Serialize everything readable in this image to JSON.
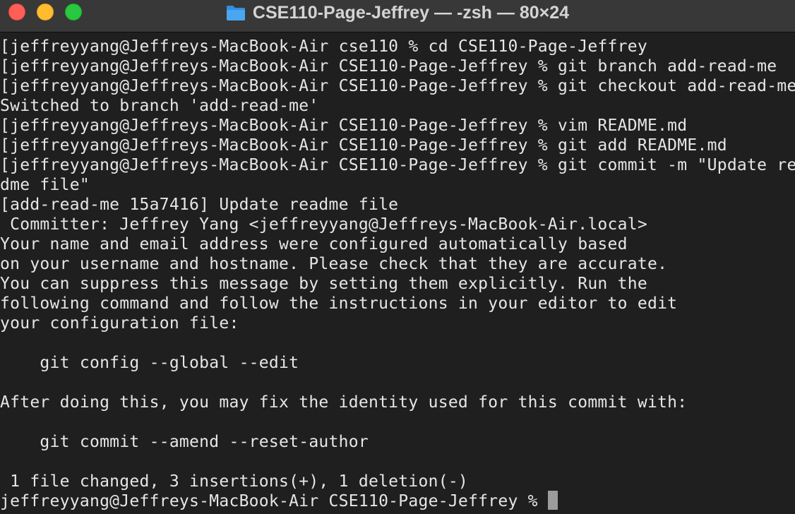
{
  "window": {
    "title": "CSE110-Page-Jeffrey — -zsh — 80×24",
    "icon": "folder-icon",
    "colors": {
      "background": "#1f1f1f",
      "titlebar": "#383838",
      "text": "#e6e6e6",
      "close": "#ff5f57",
      "minimize": "#febc2e",
      "maximize": "#28c840",
      "cursor": "#9c9c9c"
    }
  },
  "terminal": {
    "lines": [
      "[jeffreyyang@Jeffreys-MacBook-Air cse110 % cd CSE110-Page-Jeffrey",
      "[jeffreyyang@Jeffreys-MacBook-Air CSE110-Page-Jeffrey % git branch add-read-me",
      "[jeffreyyang@Jeffreys-MacBook-Air CSE110-Page-Jeffrey % git checkout add-read-me",
      "Switched to branch 'add-read-me'",
      "[jeffreyyang@Jeffreys-MacBook-Air CSE110-Page-Jeffrey % vim README.md",
      "[jeffreyyang@Jeffreys-MacBook-Air CSE110-Page-Jeffrey % git add README.md",
      "[jeffreyyang@Jeffreys-MacBook-Air CSE110-Page-Jeffrey % git commit -m \"Update rea",
      "dme file\"",
      "[add-read-me 15a7416] Update readme file",
      " Committer: Jeffrey Yang <jeffreyyang@Jeffreys-MacBook-Air.local>",
      "Your name and email address were configured automatically based",
      "on your username and hostname. Please check that they are accurate.",
      "You can suppress this message by setting them explicitly. Run the",
      "following command and follow the instructions in your editor to edit",
      "your configuration file:",
      "",
      "    git config --global --edit",
      "",
      "After doing this, you may fix the identity used for this commit with:",
      "",
      "    git commit --amend --reset-author",
      "",
      " 1 file changed, 3 insertions(+), 1 deletion(-)",
      "jeffreyyang@Jeffreys-MacBook-Air CSE110-Page-Jeffrey % "
    ]
  }
}
